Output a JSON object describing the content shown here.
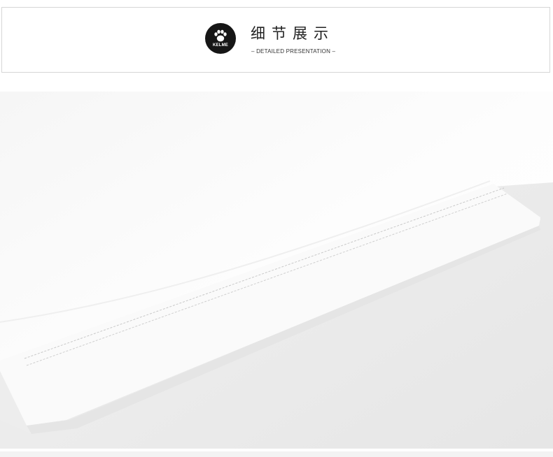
{
  "header": {
    "logo_text": "KELME",
    "logo_icon": "paw-icon",
    "title_cn": "细节展示",
    "title_en": "– DETAILED PRESENTATION –"
  },
  "colors": {
    "border": "#d6d6d6",
    "logo_bg": "#161616",
    "photo_bg": "#eeeeee",
    "fabric": "#fbfbfb"
  }
}
